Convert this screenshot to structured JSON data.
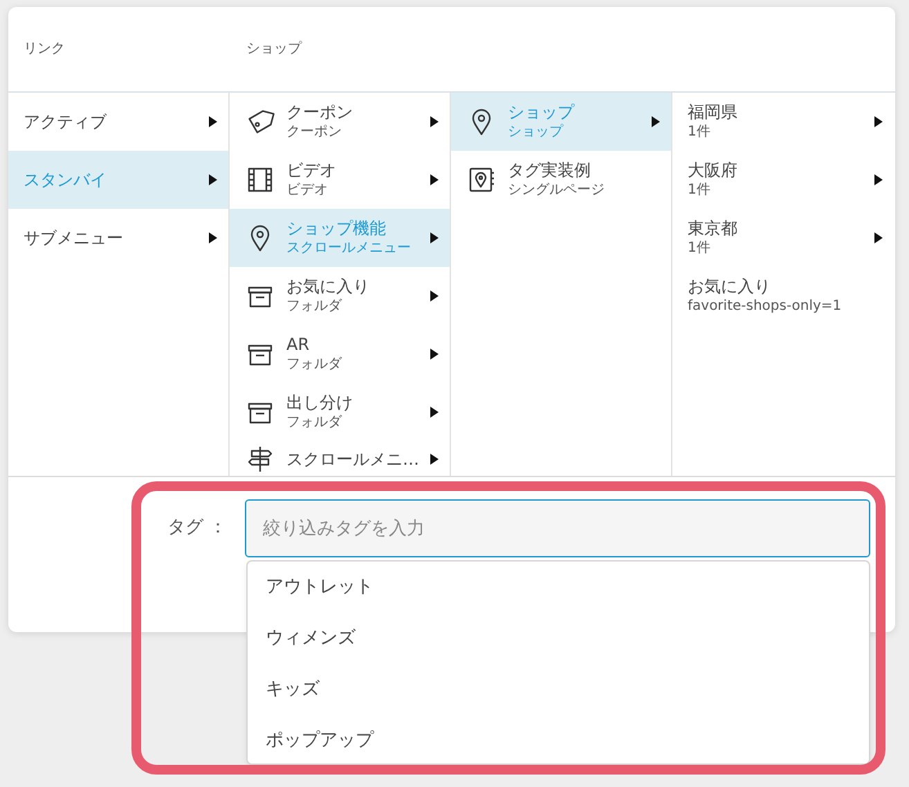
{
  "header": {
    "column_1": "リンク",
    "column_2": "ショップ"
  },
  "columns": [
    [
      {
        "title": "アクティブ",
        "has_submenu": true,
        "selected": false
      },
      {
        "title": "スタンバイ",
        "has_submenu": true,
        "selected": true
      },
      {
        "title": "サブメニュー",
        "has_submenu": true,
        "selected": false
      }
    ],
    [
      {
        "kind": "coupon",
        "title": "クーポン",
        "subtitle": "クーポン",
        "has_submenu": true,
        "selected": false
      },
      {
        "kind": "video",
        "title": "ビデオ",
        "subtitle": "ビデオ",
        "has_submenu": true,
        "selected": false
      },
      {
        "kind": "shop",
        "title": "ショップ機能",
        "subtitle": "スクロールメニュー",
        "has_submenu": true,
        "selected": true
      },
      {
        "kind": "folder",
        "title": "お気に入り",
        "subtitle": "フォルダ",
        "has_submenu": true,
        "selected": false
      },
      {
        "kind": "folder",
        "title": "AR",
        "subtitle": "フォルダ",
        "has_submenu": true,
        "selected": false
      },
      {
        "kind": "folder",
        "title": "出し分け",
        "subtitle": "フォルダ",
        "has_submenu": true,
        "selected": false
      },
      {
        "kind": "scroll_menu",
        "title": "スクロールメニ…",
        "has_submenu": true,
        "selected": false
      }
    ],
    [
      {
        "kind": "shop",
        "title": "ショップ",
        "subtitle": "ショップ",
        "has_submenu": true,
        "selected": true
      },
      {
        "kind": "single_page",
        "title": "タグ実装例",
        "subtitle": "シングルページ",
        "has_submenu": false,
        "selected": false
      }
    ],
    [
      {
        "title": "福岡県",
        "subtitle": "1件",
        "has_submenu": true,
        "selected": false
      },
      {
        "title": "大阪府",
        "subtitle": "1件",
        "has_submenu": true,
        "selected": false
      },
      {
        "title": "東京都",
        "subtitle": "1件",
        "has_submenu": true,
        "selected": false
      },
      {
        "title": "お気に入り",
        "subtitle": "favorite-shops-only=1",
        "has_submenu": false,
        "selected": false
      }
    ]
  ],
  "tag_filter": {
    "label": "タグ ：",
    "placeholder": "絞り込みタグを入力",
    "suggestions": [
      "アウトレット",
      "ウィメンズ",
      "キッズ",
      "ポップアップ"
    ]
  }
}
